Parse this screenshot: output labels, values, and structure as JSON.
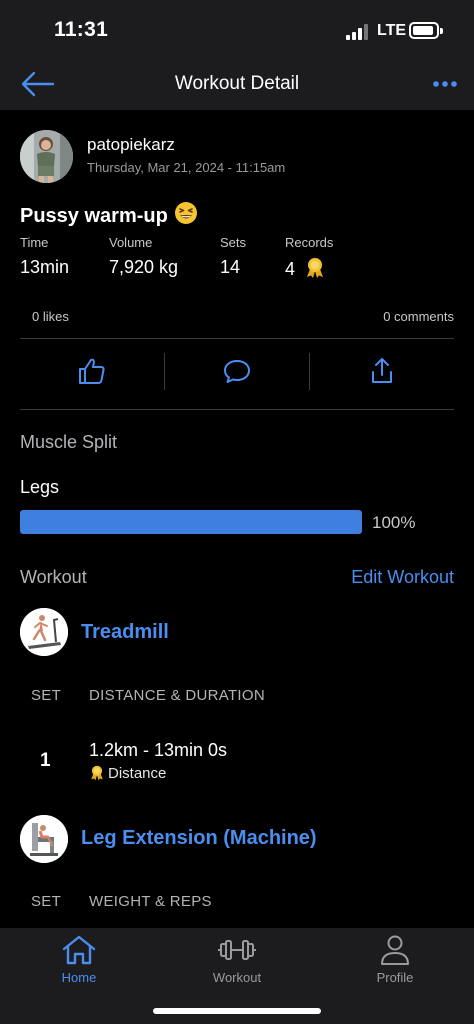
{
  "status_bar": {
    "time": "11:31",
    "network": "LTE"
  },
  "nav": {
    "title": "Workout Detail",
    "back_icon": "arrow-left-icon",
    "more_icon": "ellipsis-icon"
  },
  "post": {
    "username": "patopiekarz",
    "date": "Thursday, Mar 21, 2024 - 11:15am",
    "title": "Pussy warm-up",
    "title_emoji": "grinning-squinting-face",
    "stats": [
      {
        "label": "Time",
        "value": "13min"
      },
      {
        "label": "Volume",
        "value": "7,920 kg"
      },
      {
        "label": "Sets",
        "value": "14"
      },
      {
        "label": "Records",
        "value": "4"
      }
    ],
    "likes": "0 likes",
    "comments": "0 comments",
    "actions": [
      "thumbs-up-icon",
      "comment-bubble-icon",
      "share-icon"
    ]
  },
  "muscle_split": {
    "title": "Muscle Split",
    "items": [
      {
        "label": "Legs",
        "fraction": 1.0,
        "percent_label": "100%"
      }
    ]
  },
  "workout": {
    "title": "Workout",
    "edit_label": "Edit Workout",
    "exercises": [
      {
        "name": "Treadmill",
        "set_header": "SET",
        "value_header": "DISTANCE & DURATION",
        "sets": [
          {
            "number": "1",
            "value": "1.2km - 13min 0s",
            "record": "Distance"
          }
        ]
      },
      {
        "name": "Leg Extension (Machine)",
        "set_header": "SET",
        "value_header": "WEIGHT & REPS",
        "sets": []
      }
    ]
  },
  "tabs": [
    {
      "label": "Home",
      "icon": "home-icon",
      "active": true
    },
    {
      "label": "Workout",
      "icon": "dumbbell-icon",
      "active": false
    },
    {
      "label": "Profile",
      "icon": "person-icon",
      "active": false
    }
  ],
  "colors": {
    "accent": "#4a8ef0",
    "background": "#000000",
    "bar": "#1c1c1e",
    "medal": "#f2c230"
  }
}
